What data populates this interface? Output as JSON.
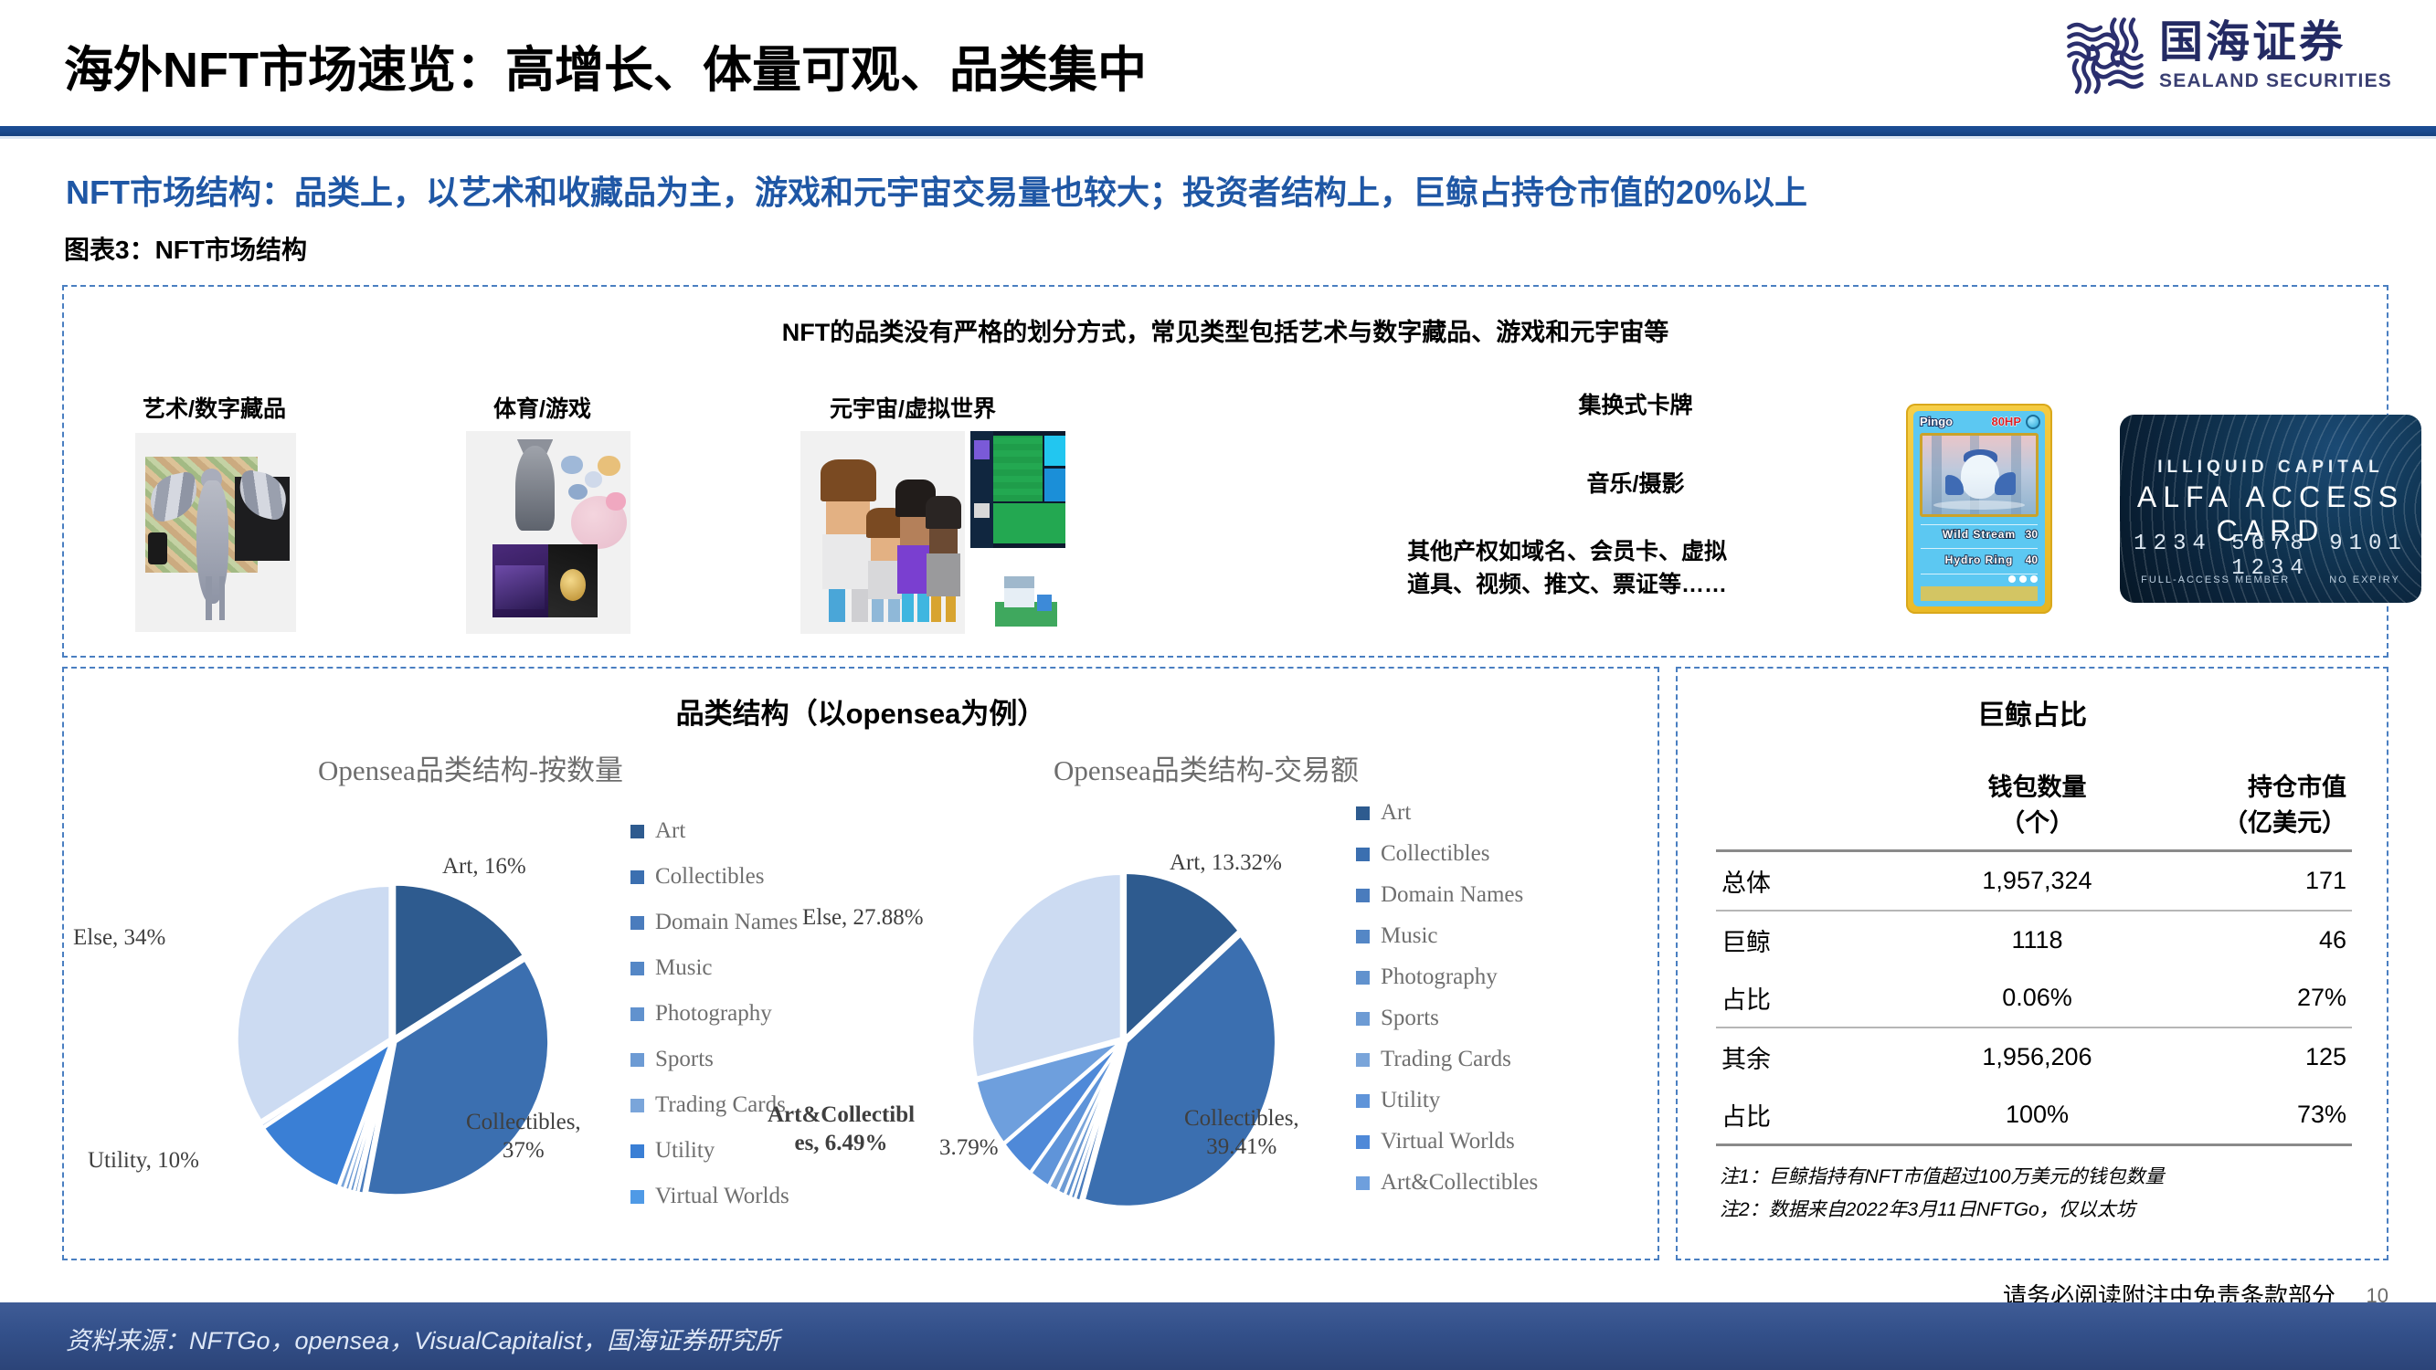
{
  "header": {
    "title": "海外NFT市场速览：高增长、体量可观、品类集中",
    "logo_cn": "国海证券",
    "logo_en": "SEALAND SECURITIES"
  },
  "subtitle": "NFT市场结构：品类上，以艺术和收藏品为主，游戏和元宇宙交易量也较大；投资者结构上，巨鲸占持仓市值的20%以上",
  "figure_label": "图表3：NFT市场结构",
  "top_panel": {
    "headline": "NFT的品类没有严格的划分方式，常见类型包括艺术与数字藏品、游戏和元宇宙等",
    "categories": [
      {
        "label": "艺术/数字藏品"
      },
      {
        "label": "体育/游戏"
      },
      {
        "label": "元宇宙/虚拟世界"
      }
    ],
    "right_labels": [
      "集换式卡牌",
      "音乐/摄影",
      "其他产权如域名、会员卡、虚拟\n道具、视频、推文、票证等……"
    ],
    "trading_card": {
      "name": "Pingo",
      "hp": "80HP",
      "move1": "Wild Stream",
      "dmg1": "30",
      "move2": "Hydro Ring",
      "dmg2": "40"
    },
    "access_card": {
      "brand": "ILLIQUID CAPITAL",
      "title": "ALFA ACCESS CARD",
      "number": "1234  5678  9101  1234",
      "left_note": "FULL-ACCESS MEMBER",
      "right_note": "NO EXPIRY"
    }
  },
  "charts_panel": {
    "title": "品类结构（以opensea为例）"
  },
  "chart_data": [
    {
      "type": "pie",
      "title": "Opensea品类结构-按数量",
      "legend_position": "right",
      "categories": [
        "Art",
        "Collectibles",
        "Domain Names",
        "Music",
        "Photography",
        "Sports",
        "Trading Cards",
        "Utility",
        "Virtual Worlds"
      ],
      "values": [
        16,
        37,
        0.6,
        0.4,
        0.5,
        0.5,
        0.6,
        10,
        0.4
      ],
      "colors": [
        "#2e5b8f",
        "#3b6fb0",
        "#4a7cbd",
        "#5487c6",
        "#6192ce",
        "#6d9bd4",
        "#7aa5da",
        "#3a7fd5",
        "#c9d9f0"
      ],
      "labels": [
        {
          "text": "Art, 16%"
        },
        {
          "text": "Collectibles,\n37%"
        },
        {
          "text": "Utility, 10%"
        },
        {
          "text": "Else, 34%"
        }
      ],
      "else_value": 34,
      "else_color": "#ccdbf2"
    },
    {
      "type": "pie",
      "title": "Opensea品类结构-交易额",
      "legend_position": "right",
      "categories": [
        "Art",
        "Collectibles",
        "Domain Names",
        "Music",
        "Photography",
        "Sports",
        "Trading Cards",
        "Utility",
        "Virtual Worlds",
        "Art&Collectibles"
      ],
      "values": [
        13.32,
        39.41,
        0.6,
        0.5,
        0.6,
        0.8,
        1.0,
        2.2,
        3.79,
        6.49
      ],
      "colors": [
        "#2e5b8f",
        "#3b6fb0",
        "#4a7cbd",
        "#5487c6",
        "#6192ce",
        "#6d9bd4",
        "#7aa5da",
        "#5f94d9",
        "#4f89d8",
        "#6e9fdd"
      ],
      "labels": [
        {
          "text": "Art, 13.32%"
        },
        {
          "text": "Collectibles,\n39.41%"
        },
        {
          "text": "Art&Collectibl\nes, 6.49%"
        },
        {
          "text": "3.79%"
        },
        {
          "text": "Else, 27.88%"
        }
      ],
      "else_value": 27.88,
      "else_color": "#ccdbf2"
    }
  ],
  "whale_table": {
    "title": "巨鲸占比",
    "columns": [
      "",
      "钱包数量\n（个）",
      "持仓市值\n（亿美元）"
    ],
    "col1_line1": "钱包数量",
    "col1_line2": "（个）",
    "col2_line1": "持仓市值",
    "col2_line2": "（亿美元）",
    "rows": [
      {
        "label": "总体",
        "wallets": "1,957,324",
        "value": "171"
      },
      {
        "label": "巨鲸",
        "wallets": "1118",
        "value": "46"
      },
      {
        "label": "占比",
        "wallets": "0.06%",
        "value": "27%"
      },
      {
        "label": "其余",
        "wallets": "1,956,206",
        "value": "125"
      },
      {
        "label": "占比",
        "wallets": "100%",
        "value": "73%"
      }
    ],
    "note1": "注1：巨鲸指持有NFT市值超过100万美元的钱包数量",
    "note2": "注2：数据来自2022年3月11日NFTGo，仅以太坊"
  },
  "footer": {
    "source": "资料来源：NFTGo，opensea，VisualCapitalist，国海证券研究所",
    "disclaimer": "请务必阅读附注中免责条款部分",
    "page_number": "10"
  }
}
